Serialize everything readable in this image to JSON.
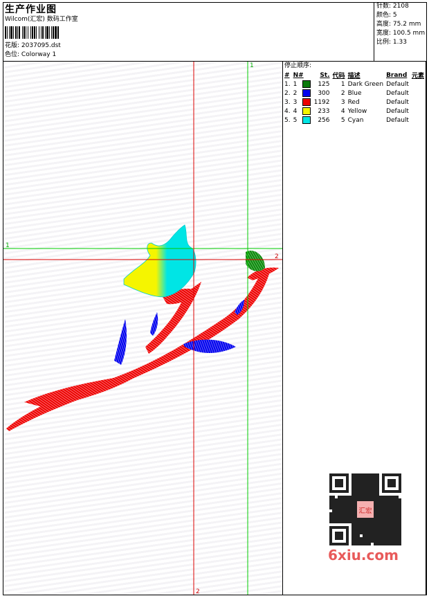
{
  "header": {
    "title": "生产作业图",
    "studio": "Wilcom(汇宏) 数码工作室",
    "design_label": "花版:",
    "design_file": "2037095.dst",
    "colorway_label": "色位:",
    "colorway": "Colorway 1"
  },
  "stats": [
    {
      "label": "针数:",
      "value": "2108"
    },
    {
      "label": "颜色:",
      "value": "5"
    },
    {
      "label": "高度:",
      "value": "75.2 mm"
    },
    {
      "label": "宽度:",
      "value": "100.5 mm"
    },
    {
      "label": "比例:",
      "value": "1.33"
    }
  ],
  "stop_sequence": {
    "title": "停止顺序:",
    "columns": [
      "#",
      "N#",
      "St.",
      "代码",
      "描述",
      "Brand",
      "元素"
    ],
    "rows": [
      {
        "idx": "1.",
        "n": "1",
        "stitches": "125",
        "code": "1",
        "desc": "Dark Green",
        "brand": "Default",
        "color": "#0b7a0b"
      },
      {
        "idx": "2.",
        "n": "2",
        "stitches": "300",
        "code": "2",
        "desc": "Blue",
        "brand": "Default",
        "color": "#0000ee"
      },
      {
        "idx": "3.",
        "n": "3",
        "stitches": "1192",
        "code": "3",
        "desc": "Red",
        "brand": "Default",
        "color": "#ee0000"
      },
      {
        "idx": "4.",
        "n": "4",
        "stitches": "233",
        "code": "4",
        "desc": "Yellow",
        "brand": "Default",
        "color": "#f5f500"
      },
      {
        "idx": "5.",
        "n": "5",
        "stitches": "256",
        "code": "5",
        "desc": "Cyan",
        "brand": "Default",
        "color": "#00e5e5"
      }
    ]
  },
  "guides": {
    "green_v_label": "1",
    "green_h_label": "1",
    "red_h_label": "2",
    "red_v_label": "2"
  },
  "watermark": {
    "site": "6xiu.com",
    "stamp": "汇宏"
  },
  "colors": {
    "guide_green": "#00cc00",
    "guide_red": "#dd0000",
    "watermark_red": "#e85a5a"
  }
}
